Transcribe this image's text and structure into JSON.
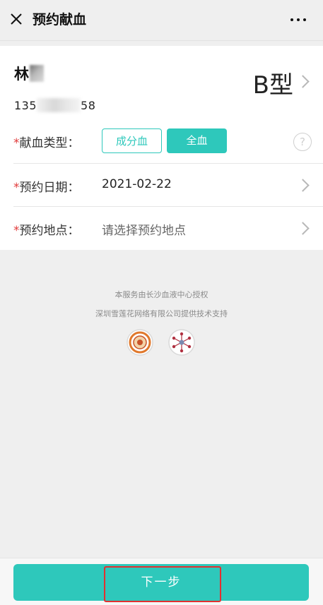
{
  "navbar": {
    "title": "预约献血",
    "close_icon": "close-icon",
    "more_icon": "more-dots-icon"
  },
  "user": {
    "name_visible": "林",
    "phone_prefix": "135",
    "phone_suffix": "58",
    "blood_type": "B型"
  },
  "form": {
    "required_mark": "*",
    "donation_type": {
      "label": "献血类型：",
      "options": [
        "成分血",
        "全血"
      ],
      "selected": "全血",
      "help_icon": "question-circle-icon",
      "help_glyph": "?"
    },
    "date": {
      "label": "预约日期：",
      "value": "2021-02-22"
    },
    "location": {
      "label": "预约地点：",
      "placeholder": "请选择预约地点"
    }
  },
  "footer": {
    "authorized_text": "本服务由长沙血液中心授权",
    "support_text": "深圳雪莲花网络有限公司提供技术支持"
  },
  "action": {
    "next_label": "下一步"
  },
  "colors": {
    "accent": "#2ec8bb",
    "required": "#e03a3a",
    "highlight": "#e23030",
    "background": "#efefef"
  }
}
